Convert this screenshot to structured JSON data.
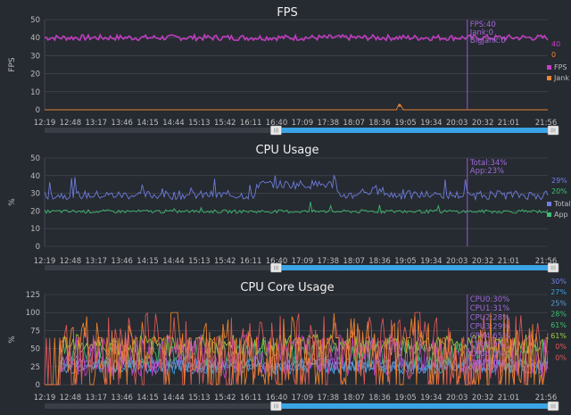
{
  "colors": {
    "background": "#262a31",
    "grid": "#4a4f57",
    "slider_track": "#3a3f47",
    "slider_fill": "#3aa4e6",
    "cursor": "#8b55c4"
  },
  "x_ticks": [
    "12:19",
    "12:48",
    "13:17",
    "13:46",
    "14:15",
    "14:44",
    "15:13",
    "15:42",
    "16:11",
    "16:40",
    "17:09",
    "17:38",
    "18:07",
    "18:36",
    "19:05",
    "19:34",
    "20:03",
    "20:32",
    "21:01",
    "21:56"
  ],
  "cursor_time": "20:32",
  "chart_data": [
    {
      "type": "line",
      "title": "FPS",
      "ylabel": "FPS",
      "ylim": [
        0,
        50
      ],
      "yticks": [
        0,
        10,
        20,
        30,
        40,
        50
      ],
      "x_range": [
        "12:19",
        "21:56"
      ],
      "series": [
        {
          "name": "FPS",
          "color": "#c63ec6",
          "approx_level": 40,
          "approx_range": [
            38,
            42
          ]
        },
        {
          "name": "Jank",
          "color": "#f0852d",
          "approx_level": 0,
          "spikes": [
            {
              "time": "19:06",
              "value": 2
            }
          ]
        }
      ],
      "cursor_readout": [
        "FPS:40",
        "Jank:0",
        "BigJank:0"
      ],
      "right_values": [
        {
          "text": "40",
          "color": "#c63ec6"
        },
        {
          "text": "0",
          "color": "#f0852d"
        }
      ],
      "legend_position": "right",
      "slider": {
        "start": 0.44,
        "end": 1.0
      }
    },
    {
      "type": "line",
      "title": "CPU Usage",
      "ylabel": "%",
      "ylim": [
        0,
        50
      ],
      "yticks": [
        0,
        10,
        20,
        30,
        40,
        50
      ],
      "x_range": [
        "12:19",
        "21:56"
      ],
      "series": [
        {
          "name": "Total",
          "color": "#7080e0",
          "approx_level": 29,
          "approx_range": [
            26,
            40
          ]
        },
        {
          "name": "App",
          "color": "#3ec070",
          "approx_level": 20,
          "approx_range": [
            18,
            24
          ]
        }
      ],
      "cursor_readout": [
        "Total:34%",
        "App:23%"
      ],
      "right_values": [
        {
          "text": "29%",
          "color": "#7080e0"
        },
        {
          "text": "20%",
          "color": "#3ec070"
        }
      ],
      "legend_position": "right",
      "slider": {
        "start": 0.44,
        "end": 1.0
      }
    },
    {
      "type": "line",
      "title": "CPU Core Usage",
      "ylabel": "%",
      "ylim": [
        0,
        125
      ],
      "yticks": [
        0,
        25,
        50,
        75,
        100,
        125
      ],
      "x_range": [
        "12:19",
        "21:56"
      ],
      "series": [
        {
          "name": "CPU0",
          "color": "#7080e0",
          "approx_range": [
            20,
            40
          ]
        },
        {
          "name": "CPU1",
          "color": "#3aa4e6",
          "approx_range": [
            15,
            35
          ]
        },
        {
          "name": "CPU2",
          "color": "#5aa0d8",
          "approx_range": [
            15,
            35
          ]
        },
        {
          "name": "CPU3",
          "color": "#3ec070",
          "approx_range": [
            25,
            65
          ]
        },
        {
          "name": "CPU4",
          "color": "#9ed040",
          "approx_range": [
            40,
            70
          ]
        },
        {
          "name": "CPU5",
          "color": "#c63ec6",
          "approx_range": [
            10,
            70
          ]
        },
        {
          "name": "CPU6",
          "color": "#e05a5a",
          "approx_range": [
            0,
            100
          ]
        },
        {
          "name": "CPU7",
          "color": "#f0852d",
          "approx_range": [
            0,
            100
          ]
        }
      ],
      "cursor_readout": [
        "CPU0:30%",
        "CPU1:31%",
        "CPU2:28%",
        "CPU3:29%",
        "CPU4:65%",
        "CPU5:0%",
        "CPU6:0%",
        "CPU7:0%"
      ],
      "right_values": [
        {
          "text": "30%",
          "color": "#7080e0"
        },
        {
          "text": "27%",
          "color": "#3aa4e6"
        },
        {
          "text": "25%",
          "color": "#5aa0d8"
        },
        {
          "text": "28%",
          "color": "#3ec070"
        },
        {
          "text": "61%",
          "color": "#3ec070"
        },
        {
          "text": "61%",
          "color": "#9ed040"
        },
        {
          "text": "0%",
          "color": "#e05a5a"
        },
        {
          "text": "0%",
          "color": "#e05a5a"
        }
      ],
      "slider": {
        "start": 0.44,
        "end": 1.0
      }
    }
  ]
}
